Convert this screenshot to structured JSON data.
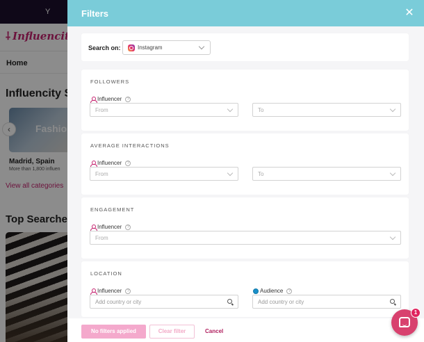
{
  "background": {
    "topbar_text": "Y",
    "brand": "Influencity",
    "nav_home": "Home",
    "section_title": "Influencity S",
    "card_label": "Fashio",
    "card_city": "Madrid, Spain",
    "card_count": "More than 1,800 influen",
    "view_all": "View all categories",
    "top_searches": "Top Searche"
  },
  "drawer": {
    "title": "Filters",
    "search_on_label": "Search on:",
    "platform": "Instagram",
    "sections": {
      "followers": {
        "title": "FOLLOWERS",
        "role": "Influencer",
        "from_placeholder": "From",
        "to_placeholder": "To"
      },
      "interactions": {
        "title": "AVERAGE INTERACTIONS",
        "role": "Influencer",
        "from_placeholder": "From",
        "to_placeholder": "To"
      },
      "engagement": {
        "title": "ENGAGEMENT",
        "role": "Influencer",
        "from_placeholder": "From"
      },
      "location": {
        "title": "LOCATION",
        "influencer_role": "Influencer",
        "audience_role": "Audience",
        "influencer_placeholder": "Add country or city",
        "audience_placeholder": "Add country or city"
      }
    },
    "footer": {
      "applied_label": "No filters applied",
      "clear_label": "Clear filter",
      "cancel_label": "Cancel"
    }
  },
  "chat": {
    "badge_count": "1"
  },
  "colors": {
    "header": "#7accd9",
    "brand": "#c5236f",
    "chat": "#d8416e"
  }
}
